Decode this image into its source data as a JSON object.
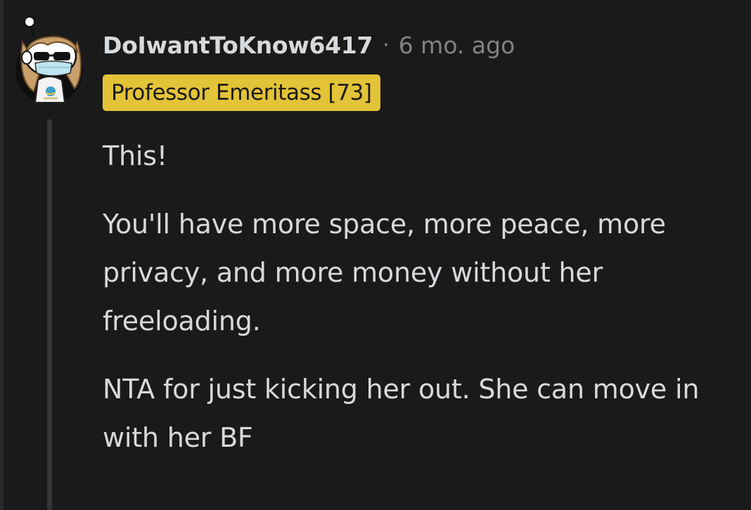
{
  "comment": {
    "author": "DoIwantToKnow6417",
    "separator": "·",
    "timestamp": "6 mo. ago",
    "flair": "Professor Emeritass [73]",
    "paragraphs": [
      "This!",
      "You'll have more space, more peace, more privacy, and more money without her freeloading.",
      "NTA for just kicking her out. She can move in with her BF"
    ]
  },
  "colors": {
    "background": "#1a1a1b",
    "text": "#d7dadc",
    "muted": "#818384",
    "flair_bg": "#e3c337",
    "thread_line": "#343536"
  },
  "icons": {
    "avatar": "snoo-avatar-sunglasses-mask"
  }
}
